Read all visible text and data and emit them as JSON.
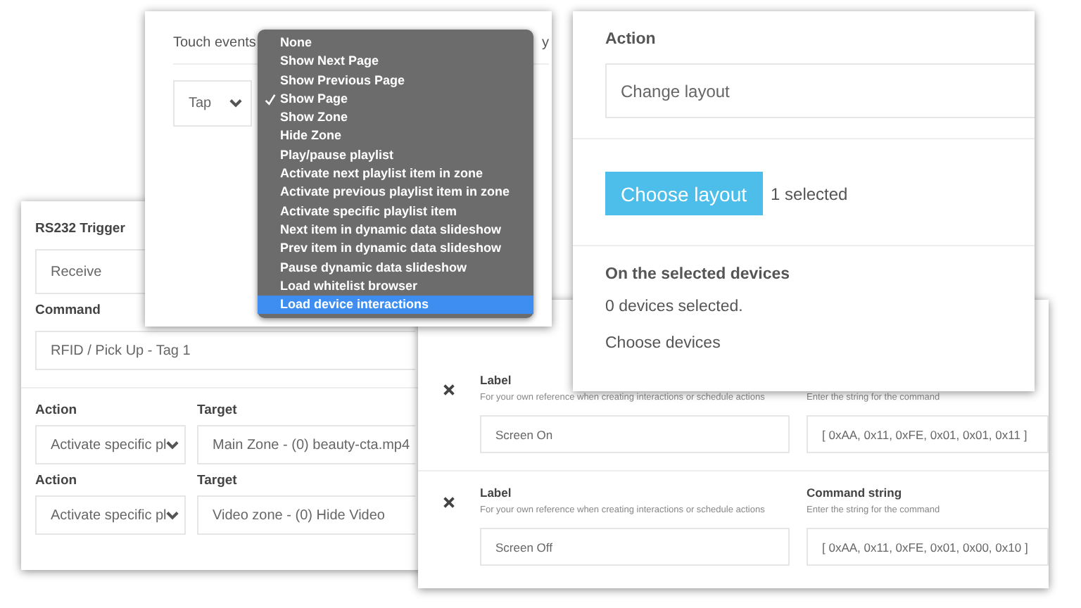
{
  "rs232_panel": {
    "title": "RS232 Trigger",
    "mode": "Receive",
    "command_label": "Command",
    "command": "RFID / Pick Up - Tag 1",
    "actions": [
      {
        "action_label": "Action",
        "target_label": "Target",
        "action": "Activate specific pl",
        "target": "Main Zone - (0) beauty-cta.mp4"
      },
      {
        "action_label": "Action",
        "target_label": "Target",
        "action": "Activate specific pl",
        "target": "Video zone - (0) Hide Video"
      }
    ]
  },
  "commands_panel": {
    "rows": [
      {
        "label_title": "Label",
        "label_hint": "For your own reference when creating interactions or schedule actions",
        "label_value": "Screen On",
        "command_title": "",
        "command_hint": "Enter the string for the command",
        "command_value": "[ 0xAA, 0x11, 0xFE, 0x01, 0x01, 0x11 ]"
      },
      {
        "label_title": "Label",
        "label_hint": "For your own reference when creating interactions or schedule actions",
        "label_value": "Screen Off",
        "command_title": "Command string",
        "command_hint": "Enter the string for the command",
        "command_value": "[ 0xAA, 0x11, 0xFE, 0x01, 0x00, 0x10 ]"
      }
    ]
  },
  "touch_panel": {
    "title": "Touch events",
    "title_right": "y",
    "event": "Tap",
    "menu": [
      {
        "label": "None",
        "checked": false,
        "highlighted": false
      },
      {
        "label": "Show Next Page",
        "checked": false,
        "highlighted": false
      },
      {
        "label": "Show Previous Page",
        "checked": false,
        "highlighted": false
      },
      {
        "label": "Show Page",
        "checked": true,
        "highlighted": false
      },
      {
        "label": "Show Zone",
        "checked": false,
        "highlighted": false
      },
      {
        "label": "Hide Zone",
        "checked": false,
        "highlighted": false
      },
      {
        "label": "Play/pause playlist",
        "checked": false,
        "highlighted": false
      },
      {
        "label": "Activate next playlist item in zone",
        "checked": false,
        "highlighted": false
      },
      {
        "label": "Activate previous playlist item in zone",
        "checked": false,
        "highlighted": false
      },
      {
        "label": "Activate specific playlist item",
        "checked": false,
        "highlighted": false
      },
      {
        "label": "Next item in dynamic data slideshow",
        "checked": false,
        "highlighted": false
      },
      {
        "label": "Prev item in dynamic data slideshow",
        "checked": false,
        "highlighted": false
      },
      {
        "label": "Pause dynamic data slideshow",
        "checked": false,
        "highlighted": false
      },
      {
        "label": "Load whitelist browser",
        "checked": false,
        "highlighted": false
      },
      {
        "label": "Load device interactions",
        "checked": false,
        "highlighted": true
      }
    ]
  },
  "layout_panel": {
    "action_label": "Action",
    "action": "Change layout",
    "button": "Choose layout",
    "selected_count": "1 selected",
    "devices_title": "On the selected devices",
    "devices_count": "0 devices selected.",
    "devices_link": "Choose devices"
  }
}
